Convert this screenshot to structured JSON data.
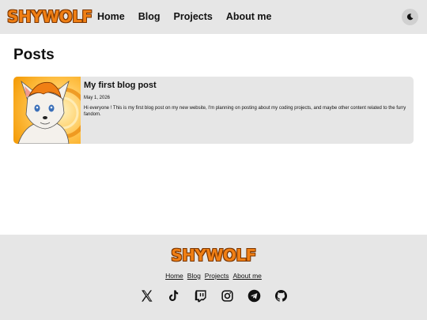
{
  "header": {
    "logo": "SHYWOLF",
    "nav": [
      "Home",
      "Blog",
      "Projects",
      "About me"
    ],
    "theme_toggle_icon": "moon-icon"
  },
  "main": {
    "title": "Posts",
    "posts": [
      {
        "title": "My first blog post",
        "date": "May 1, 2026",
        "excerpt": "Hi everyone ! This is my first blog post on my new website, I'm planning on posting about my coding projects, and maybe other content related to the furry fandom.",
        "thumbnail": "fox-character-illustration"
      }
    ]
  },
  "footer": {
    "logo": "SHYWOLF",
    "links": [
      "Home",
      "Blog",
      "Projects",
      "About me"
    ],
    "social_icons": [
      "x-icon",
      "tiktok-icon",
      "twitch-icon",
      "instagram-icon",
      "telegram-icon",
      "github-icon"
    ]
  },
  "colors": {
    "brand_orange": "#f07f14",
    "bar_gray": "#e6e6e6",
    "card_gray": "#e6e6e6"
  }
}
